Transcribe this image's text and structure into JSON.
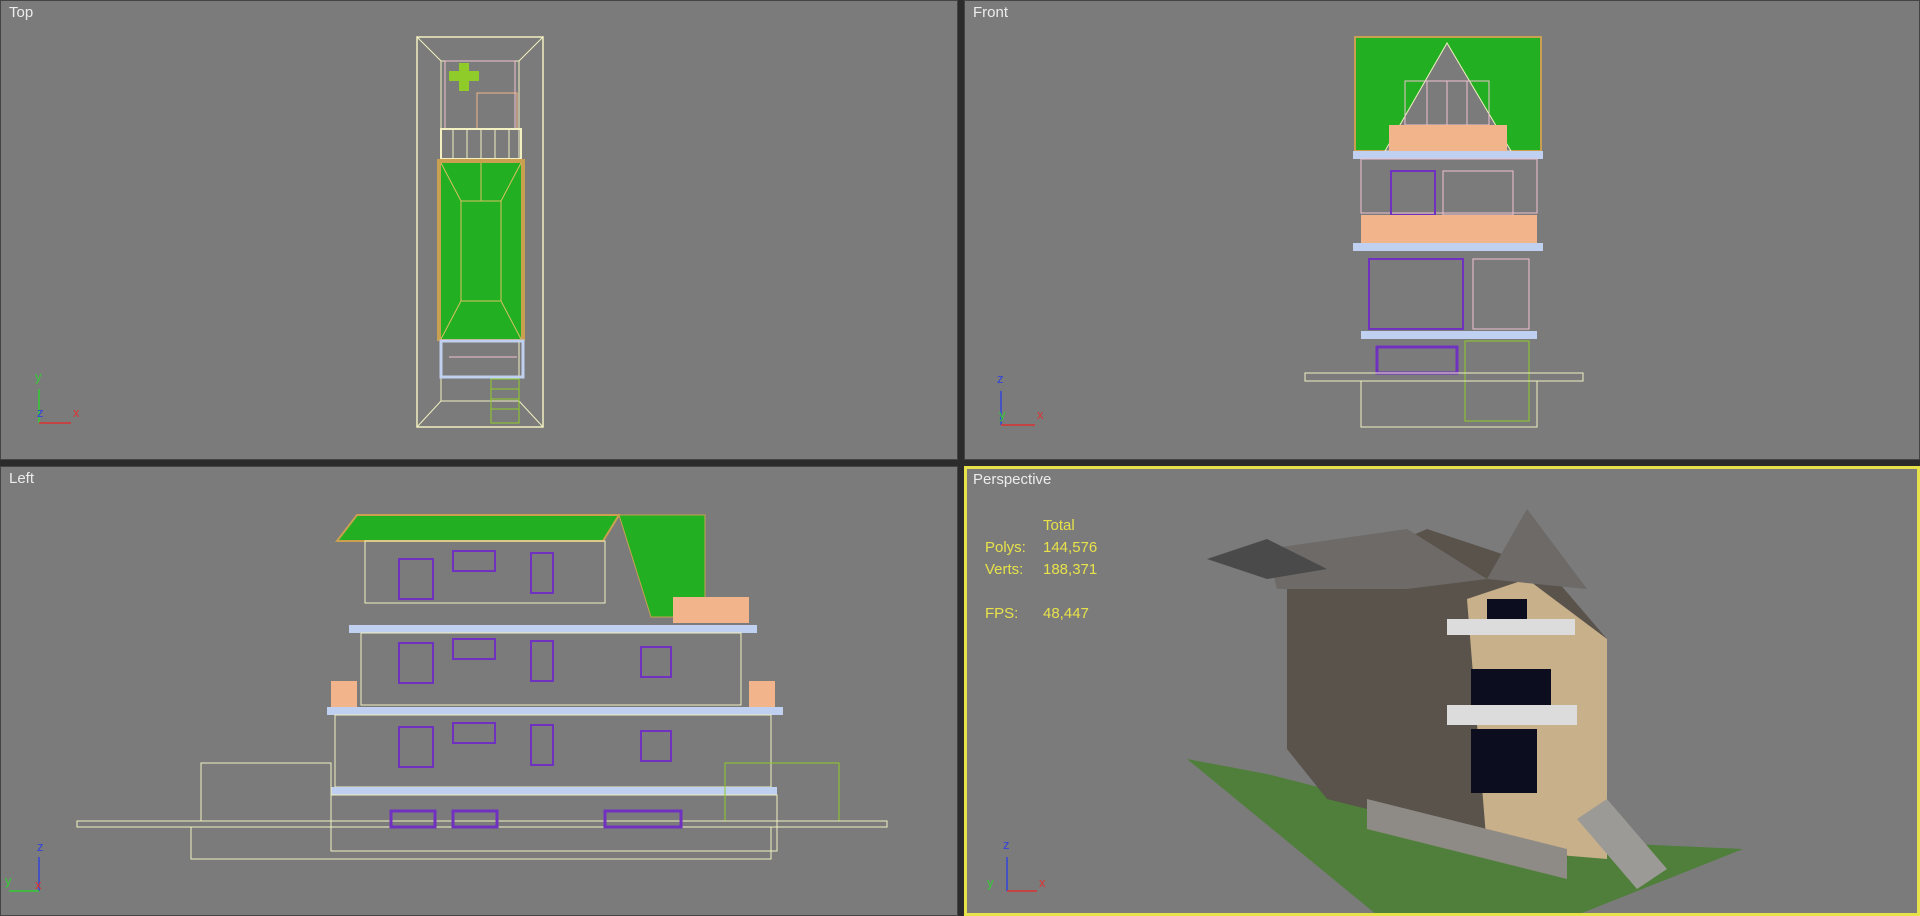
{
  "viewports": {
    "top": {
      "label": "Top",
      "axes": {
        "a": "y",
        "b": "x",
        "c": "z"
      }
    },
    "front": {
      "label": "Front",
      "axes": {
        "a": "z",
        "b": "x",
        "c": "y"
      }
    },
    "left": {
      "label": "Left",
      "axes": {
        "a": "z",
        "b": "x",
        "c": "y"
      }
    },
    "perspective": {
      "label": "Perspective",
      "axes": {
        "a": "z",
        "b": "x",
        "c": "y"
      }
    }
  },
  "stats": {
    "header": "Total",
    "polys_label": "Polys:",
    "polys_value": "144,576",
    "verts_label": "Verts:",
    "verts_value": "188,371",
    "fps_label": "FPS:",
    "fps_value": "48,447"
  },
  "colors": {
    "viewport_bg": "#7b7b7b",
    "active_border": "#e8e24a",
    "roof_green": "#22b022",
    "wire_cream": "#f2f0c0",
    "wire_purple": "#7030c0",
    "wire_peach": "#f2b48a",
    "wire_pink": "#f0c0d0",
    "wire_blue": "#c0d0f0",
    "stats_yellow": "#e8e24a"
  }
}
